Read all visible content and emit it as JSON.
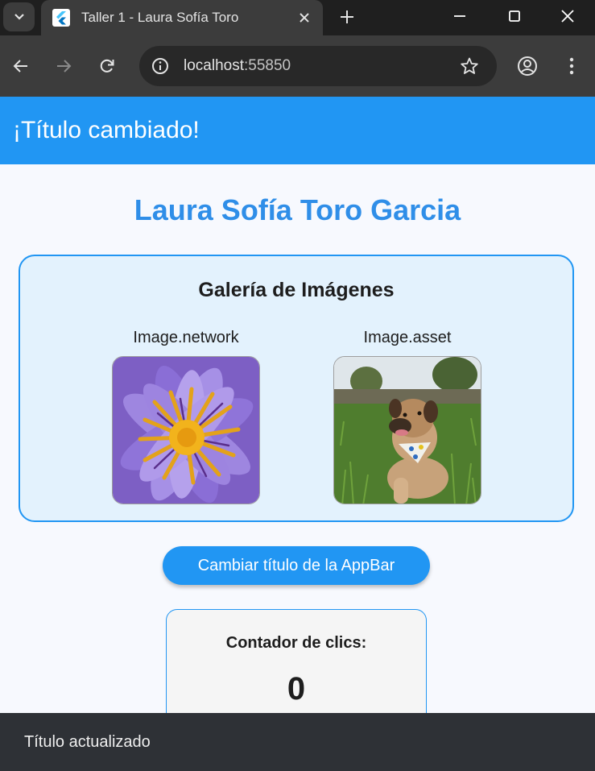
{
  "browser": {
    "tab_title": "Taller 1 - Laura Sofía Toro",
    "url_host": "localhost",
    "url_port": ":55850",
    "icons": {
      "tab_search": "chevron-down-icon",
      "favicon": "flutter-icon",
      "tab_close": "close-icon",
      "new_tab": "plus-icon",
      "minimize": "minimize-icon",
      "maximize": "maximize-icon",
      "close_window": "close-icon",
      "back": "arrow-left-icon",
      "forward": "arrow-right-icon",
      "reload": "reload-icon",
      "site_info": "info-icon",
      "bookmark": "star-icon",
      "profile": "account-icon",
      "menu": "kebab-menu-icon"
    }
  },
  "appbar": {
    "title": "¡Título cambiado!",
    "color": "#2196f3"
  },
  "page": {
    "name": "Laura Sofía Toro Garcia",
    "gallery": {
      "title": "Galería de Imágenes",
      "images": [
        {
          "label": "Image.network",
          "subject": "purple water lily flower"
        },
        {
          "label": "Image.asset",
          "subject": "dog with bandana lying in grass"
        }
      ]
    },
    "change_title_button": "Cambiar título de la AppBar",
    "counter": {
      "label": "Contador de clics:",
      "value": "0"
    }
  },
  "snackbar": {
    "message": "Título actualizado"
  }
}
